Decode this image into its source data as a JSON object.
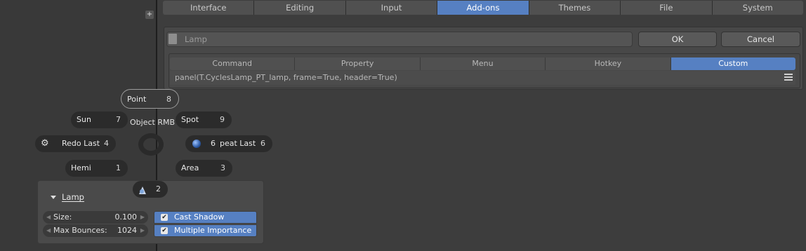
{
  "prefs_tabs": [
    "Interface",
    "Editing",
    "Input",
    "Add-ons",
    "Themes",
    "File",
    "System"
  ],
  "active_prefs_tab": "Add-ons",
  "editor": {
    "name_value": "Lamp",
    "ok_label": "OK",
    "cancel_label": "Cancel",
    "subtabs": [
      "Command",
      "Property",
      "Menu",
      "Hotkey",
      "Custom"
    ],
    "active_subtab": "Custom",
    "code": "panel(T.CyclesLamp_PT_lamp, frame=True, header=True)"
  },
  "pie": {
    "title": "Object RMB",
    "point": {
      "label": "Point",
      "key": "8"
    },
    "sun": {
      "label": "Sun",
      "key": "7"
    },
    "spot": {
      "label": "Spot",
      "key": "9"
    },
    "redo": {
      "label": "Redo Last",
      "key": "4"
    },
    "repeat": {
      "prefix": "6",
      "label": "peat Last",
      "key": "6"
    },
    "hemi": {
      "label": "Hemi",
      "key": "1"
    },
    "area": {
      "label": "Area",
      "key": "3"
    },
    "bottom": {
      "key": "2"
    }
  },
  "lamp_panel": {
    "title": "Lamp",
    "size_label": "Size:",
    "size_value": "0.100",
    "bounces_label": "Max Bounces:",
    "bounces_value": "1024",
    "cast_shadow_label": "Cast Shadow",
    "cast_shadow_checked": true,
    "multiple_importance_label": "Multiple Importance",
    "multiple_importance_checked": true
  },
  "colors": {
    "accent": "#5680c2",
    "background": "#393939"
  }
}
